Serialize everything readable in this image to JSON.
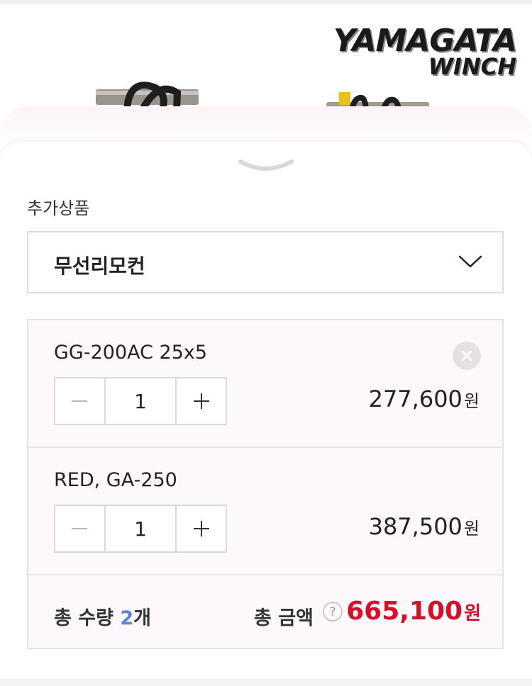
{
  "product_banner": {
    "brand_line1": "YAMAGATA",
    "brand_line2": "WINCH"
  },
  "options": {
    "section_title": "추가상품",
    "select_value": "무선리모컨"
  },
  "cart": {
    "items": [
      {
        "name": "GG-200AC 25x5",
        "quantity": "1",
        "price": "277,600",
        "currency": "원"
      },
      {
        "name": "RED, GA-250",
        "quantity": "1",
        "price": "387,500",
        "currency": "원"
      }
    ],
    "summary": {
      "count_label": "총 수량",
      "count_value": "2",
      "count_unit": "개",
      "total_label": "총 금액",
      "total_amount": "665,100",
      "currency": "원"
    }
  },
  "colors": {
    "accent_red": "#d4102a",
    "count_blue": "#5b86d6"
  }
}
